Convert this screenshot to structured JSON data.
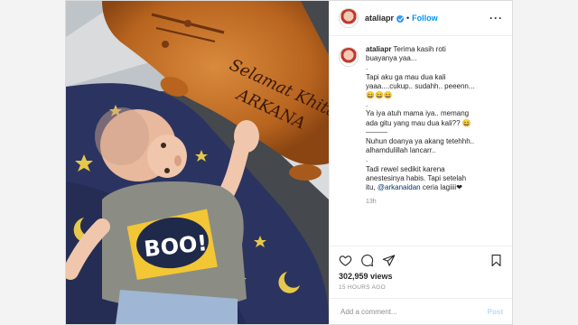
{
  "header": {
    "username": "ataliapr",
    "separator": "•",
    "follow_label": "Follow",
    "more_icon": "more-horizontal-icon"
  },
  "photo": {
    "bread_text_line1": "Selamat Khitan",
    "bread_text_line2": "ARKANA",
    "shirt_text": "BOO!"
  },
  "caption": {
    "username": "ataliapr",
    "p1": "Terima kasih roti buayanya yaa...",
    "p2": ".",
    "p3": "Tapi aku ga mau dua kali yaaa....cukup.. sudahh.. peeenn... 😄😄😄",
    "p4": ".",
    "p5": "Ya iya atuh mama iya.. memang ada gitu yang mau dua kali?? 😄",
    "p6": "———",
    "p7": "Nuhun doanya ya akang tetehhh.. alhamdulillah lancarr..",
    "p8": ".",
    "p9a": "Tadi rewel sedikit karena anestesinya habis. Tapi setelah itu, ",
    "mention": "@arkanaidan",
    "p9b": " ceria lagiiii❤",
    "time": "13h"
  },
  "actions": {
    "icons": [
      "heart-icon",
      "comment-icon",
      "share-icon",
      "bookmark-icon"
    ]
  },
  "likes": "302,959 views",
  "posted_ago": "15 HOURS AGO",
  "comment_box": {
    "placeholder": "Add a comment...",
    "post_label": "Post"
  }
}
